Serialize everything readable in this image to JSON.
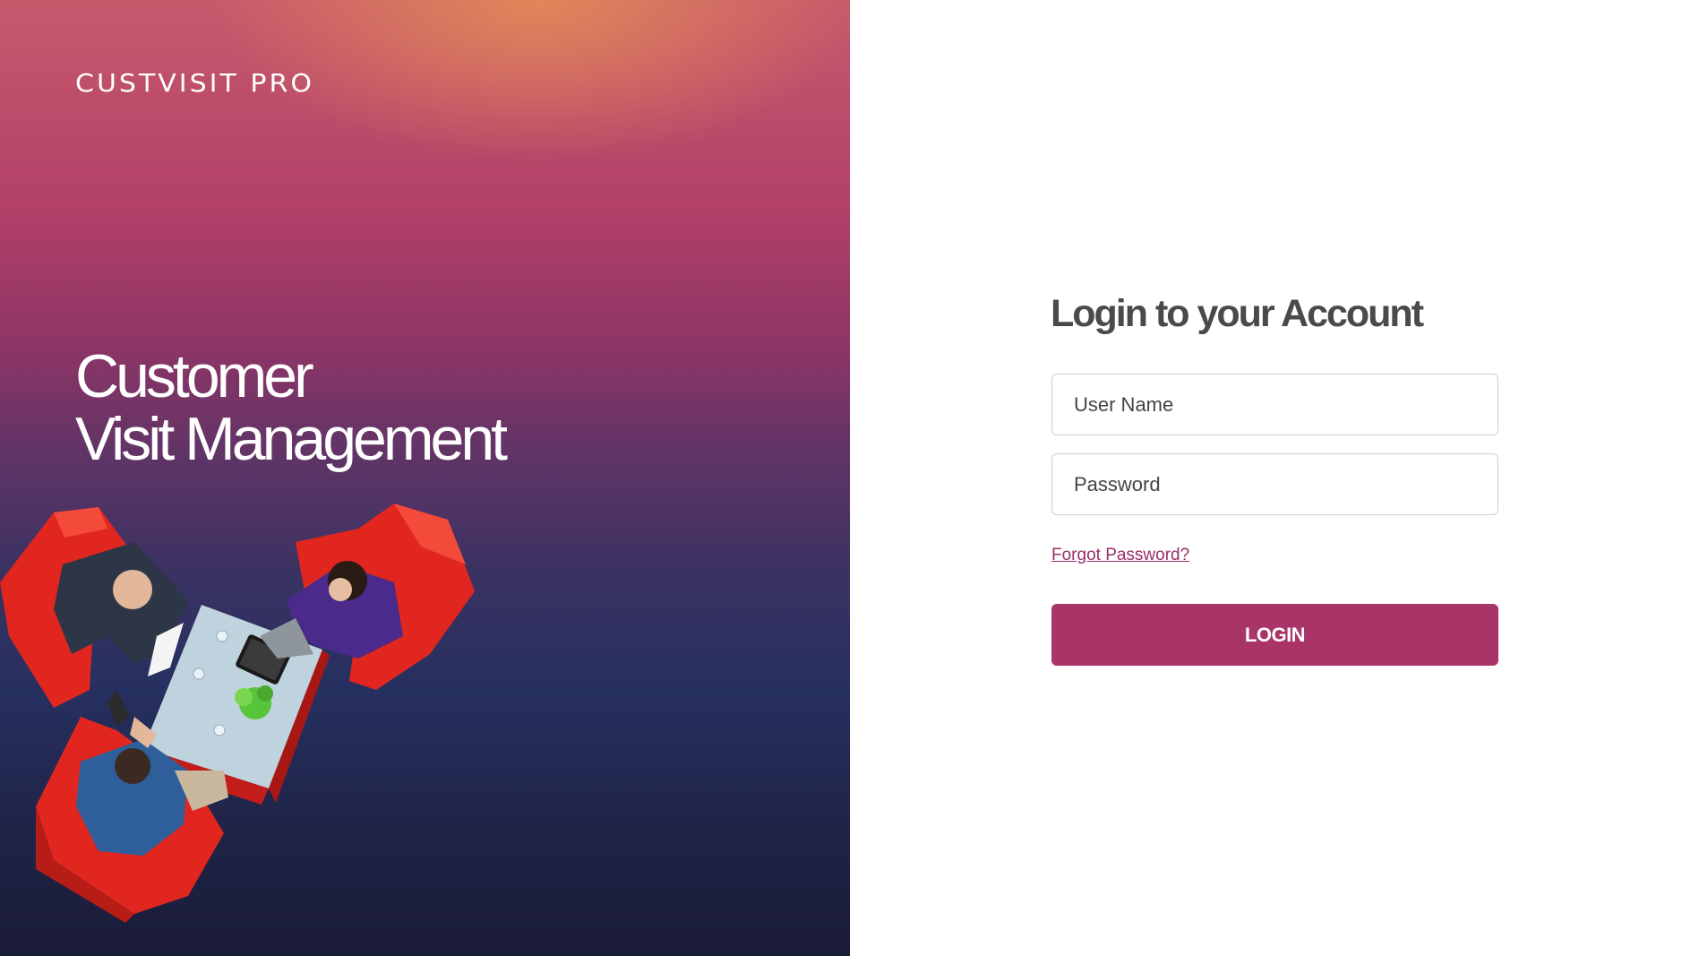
{
  "hero": {
    "brand": "CUSTVISIT PRO",
    "tagline_line1": "Customer",
    "tagline_line2": "Visit Management",
    "illustration_icon": "meeting-illustration"
  },
  "login": {
    "title": "Login to your Account",
    "username_placeholder": "User Name",
    "password_placeholder": "Password",
    "forgot_password": "Forgot Password?",
    "login_button": "LOGIN"
  },
  "colors": {
    "accent": "#a93467",
    "link": "#9b2e68",
    "title_text": "#4a4a4a",
    "field_border": "#cfcfcf"
  }
}
